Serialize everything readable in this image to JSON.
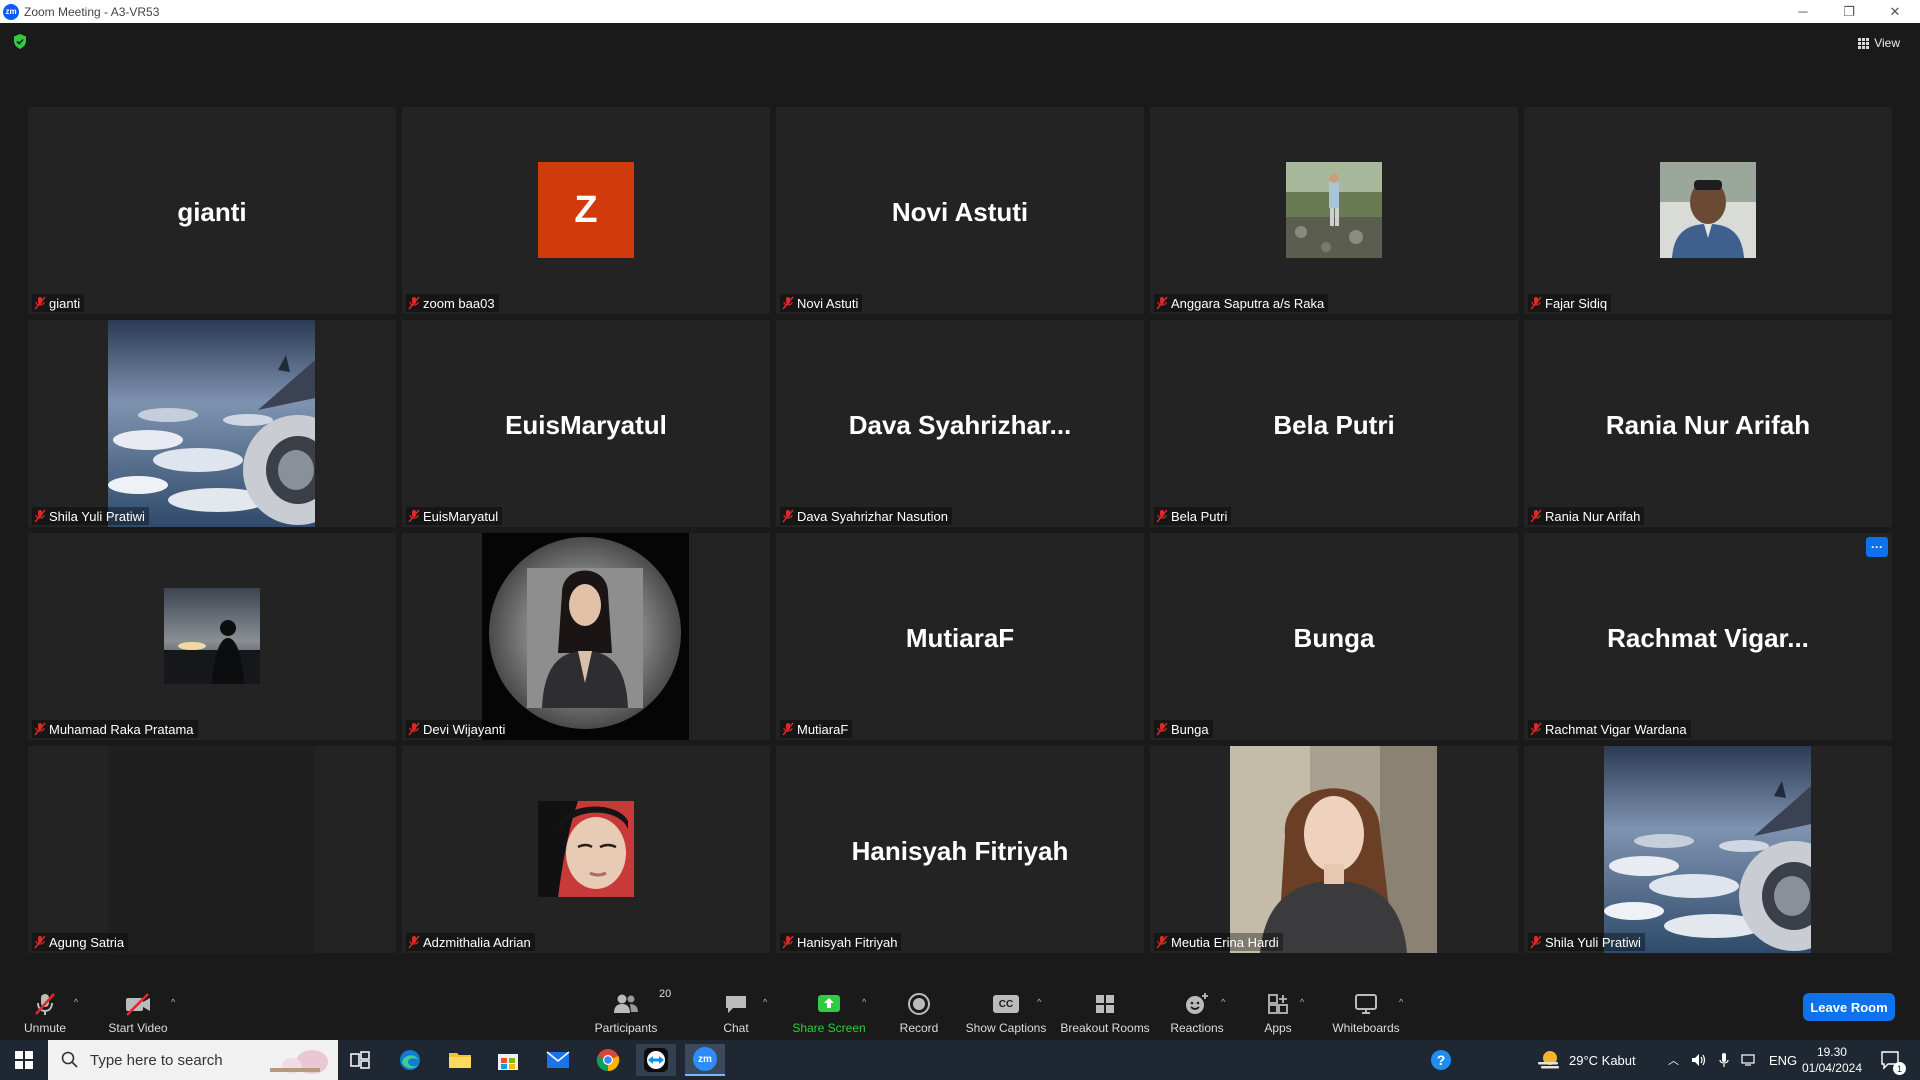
{
  "window": {
    "title": "Zoom Meeting - A3-VR53",
    "logo_text": "zm",
    "minimize": "─",
    "restore": "❐",
    "close": "✕"
  },
  "header": {
    "view_label": "View"
  },
  "tiles": [
    {
      "name": "gianti",
      "display": "gianti",
      "kind": "name"
    },
    {
      "name": "zoom baa03",
      "display": "Z",
      "kind": "letter"
    },
    {
      "name": "Novi Astuti",
      "display": "Novi Astuti",
      "kind": "name"
    },
    {
      "name": "Anggara Saputra a/s Raka",
      "display": "",
      "kind": "photo-outdoor"
    },
    {
      "name": "Fajar Sidiq",
      "display": "",
      "kind": "photo-man"
    },
    {
      "name": "Shila Yuli Pratiwi",
      "display": "",
      "kind": "photo-sky"
    },
    {
      "name": "EuisMaryatul",
      "display": "EuisMaryatul",
      "kind": "name"
    },
    {
      "name": "Dava Syahrizhar Nasution",
      "display": "Dava  Syahrizhar...",
      "kind": "name"
    },
    {
      "name": "Bela Putri",
      "display": "Bela Putri",
      "kind": "name"
    },
    {
      "name": "Rania Nur Arifah",
      "display": "Rania Nur Arifah",
      "kind": "name"
    },
    {
      "name": "Muhamad Raka Pratama",
      "display": "",
      "kind": "photo-silhouette"
    },
    {
      "name": "Devi Wijayanti",
      "display": "",
      "kind": "photo-portrait"
    },
    {
      "name": "MutiaraF",
      "display": "MutiaraF",
      "kind": "name"
    },
    {
      "name": "Bunga",
      "display": "Bunga",
      "kind": "name"
    },
    {
      "name": "Rachmat Vigar Wardana",
      "display": "Rachmat  Vigar...",
      "kind": "name"
    },
    {
      "name": "Agung Satria",
      "display": "",
      "kind": "empty"
    },
    {
      "name": "Adzmithalia Adrian",
      "display": "",
      "kind": "photo-hijab"
    },
    {
      "name": "Hanisyah Fitriyah",
      "display": "Hanisyah Fitriyah",
      "kind": "name"
    },
    {
      "name": "Meutia Erina Hardi",
      "display": "",
      "kind": "photo-girl"
    },
    {
      "name": "Shila Yuli Pratiwi",
      "display": "",
      "kind": "photo-sky"
    }
  ],
  "more_button": "···",
  "toolbar": {
    "unmute": "Unmute",
    "start_video": "Start Video",
    "participants": "Participants",
    "participants_count": "20",
    "chat": "Chat",
    "share_screen": "Share Screen",
    "record": "Record",
    "show_captions": "Show Captions",
    "cc_text": "CC",
    "breakout_rooms": "Breakout Rooms",
    "reactions": "Reactions",
    "apps": "Apps",
    "whiteboards": "Whiteboards",
    "leave_room": "Leave Room",
    "caret": "^"
  },
  "taskbar": {
    "search_placeholder": "Type here to search",
    "weather": "29°C  Kabut",
    "language": "ENG",
    "time": "19.30",
    "date": "01/04/2024",
    "notifications": "1",
    "zoom_icon_text": "zm"
  },
  "colors": {
    "accent_blue": "#0e72ed",
    "share_green": "#2ecc40",
    "muted_red": "#e02828",
    "letter_avatar": "#d13a0b"
  }
}
